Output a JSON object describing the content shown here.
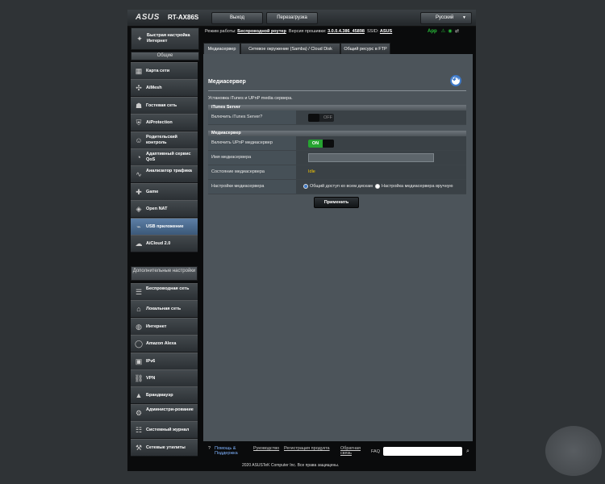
{
  "header": {
    "logo": "ASUS",
    "model": "RT-AX86S",
    "logout_label": "Выход",
    "reboot_label": "Перезагрузка",
    "language": "Русский"
  },
  "sidebar": {
    "quick_setup": "Быстрая настройка Интернет",
    "general_title": "Общие",
    "general_items": [
      {
        "label": "Карта сети",
        "icon": "network-map-icon"
      },
      {
        "label": "AiMesh",
        "icon": "aimesh-icon"
      },
      {
        "label": "Гостевая сеть",
        "icon": "guest-network-icon"
      },
      {
        "label": "AiProtection",
        "icon": "aiprotection-icon"
      },
      {
        "label": "Родительский контроль",
        "icon": "parental-control-icon"
      },
      {
        "label": "Адаптивный сервис QoS",
        "icon": "qos-icon"
      },
      {
        "label": "Анализатор трафика",
        "icon": "traffic-analyzer-icon"
      },
      {
        "label": "Game",
        "icon": "game-icon"
      },
      {
        "label": "Open NAT",
        "icon": "open-nat-icon"
      },
      {
        "label": "USB приложение",
        "icon": "usb-icon"
      },
      {
        "label": "AiCloud 2.0",
        "icon": "aicloud-icon"
      }
    ],
    "advanced_title": "Дополнительные настройки",
    "advanced_items": [
      {
        "label": "Беспроводная сеть",
        "icon": "wireless-icon"
      },
      {
        "label": "Локальная сеть",
        "icon": "lan-icon"
      },
      {
        "label": "Интернет",
        "icon": "globe-icon"
      },
      {
        "label": "Amazon Alexa",
        "icon": "alexa-icon"
      },
      {
        "label": "IPv6",
        "icon": "ipv6-icon"
      },
      {
        "label": "VPN",
        "icon": "vpn-icon"
      },
      {
        "label": "Брандмауэр",
        "icon": "firewall-icon"
      },
      {
        "label": "Администри-рование",
        "icon": "admin-icon"
      },
      {
        "label": "Системный журнал",
        "icon": "system-log-icon"
      },
      {
        "label": "Сетевые утилиты",
        "icon": "network-tools-icon"
      }
    ]
  },
  "status": {
    "mode_label": "Режим работы:",
    "mode_value": "Беспроводной роутер",
    "firmware_label": "Версия прошивки:",
    "firmware_value": "3.0.0.4.386_45898",
    "ssid_label": "SSID:",
    "ssid_value": "ASUS",
    "app_label": "App"
  },
  "tabs": [
    {
      "label": "Медиасервер"
    },
    {
      "label": "Сетевое окружение (Samba) / Cloud Disk"
    },
    {
      "label": "Общий ресурс в FTP"
    }
  ],
  "panel": {
    "title": "Медиасервер",
    "description": "Установка iTunes и UPnP media сервера.",
    "itunes_header": "iTunes Server",
    "itunes_label": "Включить iTunes Server?",
    "itunes_toggle": "OFF",
    "media_header": "Медиасервер",
    "upnp_label": "Включить UPnP медиасервер",
    "upnp_toggle": "ON",
    "name_label": "Имя медиасервера",
    "name_value": "",
    "state_label": "Состояние медиасервера",
    "state_value": "Idle",
    "settings_label": "Настройки медиасервера",
    "option_all": "Общий доступ ко всем дискам",
    "option_manual": "Настройка медиасервера вручную",
    "apply_label": "Применить"
  },
  "footer": {
    "help_label": "Помощь & Поддержка",
    "manual_link": "Руководство",
    "register_link": "Регистрация продукта",
    "feedback_link": "Обратная связь",
    "faq_label": "FAQ",
    "copyright": "2020 ASUSTeK Computer Inc. Все права защищены."
  }
}
